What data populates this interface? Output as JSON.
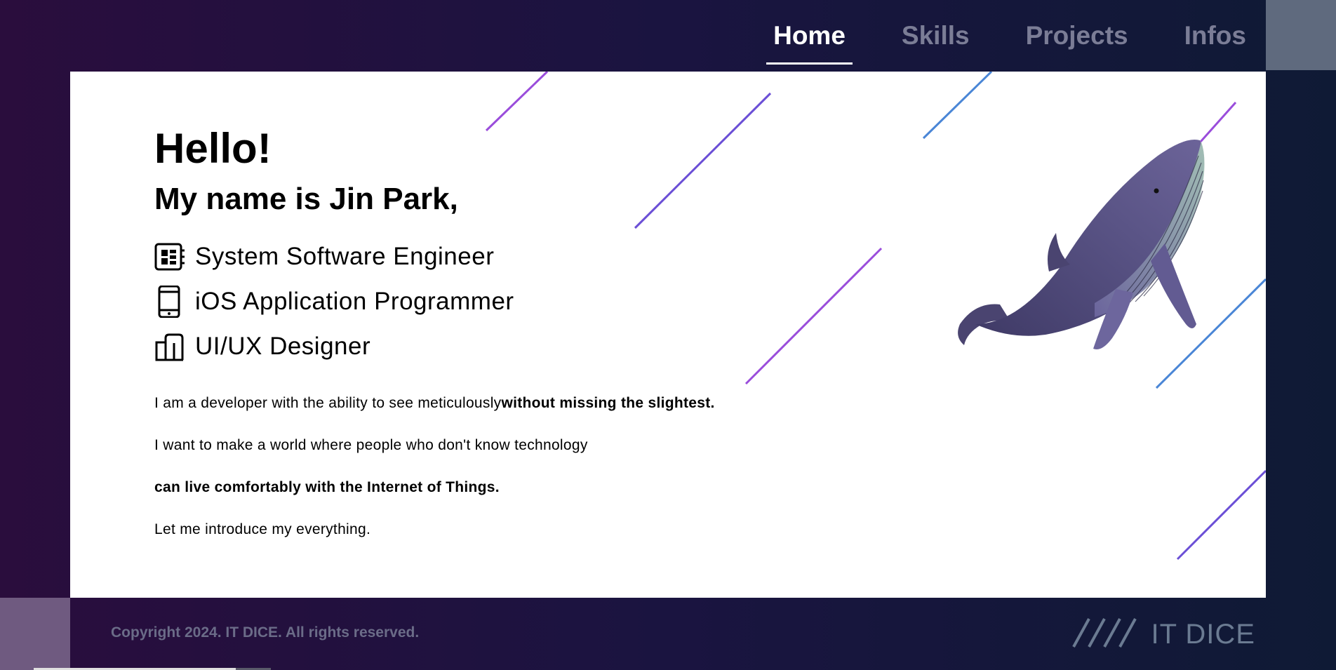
{
  "nav": {
    "items": [
      {
        "label": "Home",
        "active": true
      },
      {
        "label": "Skills",
        "active": false
      },
      {
        "label": "Projects",
        "active": false
      },
      {
        "label": "Infos",
        "active": false
      }
    ]
  },
  "hero": {
    "greeting": "Hello!",
    "name_line": "My name is Jin Park,",
    "roles": [
      {
        "icon": "cpu-chip-icon",
        "label": "System Software Engineer"
      },
      {
        "icon": "smartphone-icon",
        "label": "iOS Application Programmer"
      },
      {
        "icon": "design-blocks-icon",
        "label": "UI/UX Designer"
      }
    ],
    "bio": {
      "line1_regular": "I am a developer with the ability to see meticulously",
      "line1_bold": "without missing the slightest.",
      "line2": "I want to make a world where people who don't know technology",
      "line3_bold": "can live comfortably with the Internet of Things.",
      "line4": "Let me introduce my everything."
    }
  },
  "footer": {
    "copyright": "Copyright 2024. IT DICE. All rights reserved.",
    "logo_text": "IT DICE",
    "logo_mark": "////"
  },
  "colors": {
    "background_start": "#2a0d3d",
    "background_end": "#0f1a35",
    "nav_inactive": "#7b7d96",
    "accent_purple": "#9a4ddb",
    "accent_blue": "#4a86d6"
  }
}
